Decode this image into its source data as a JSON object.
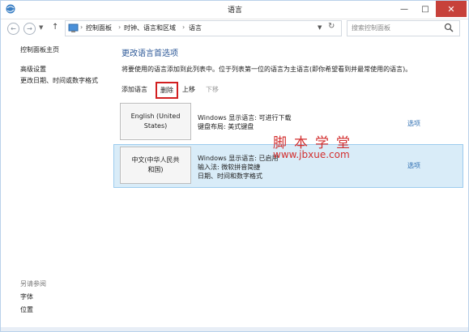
{
  "window": {
    "title": "语言"
  },
  "address": {
    "breadcrumbs": [
      "控制面板",
      "时钟、语言和区域",
      "语言"
    ],
    "separator": "›",
    "search_placeholder": "搜索控制面板"
  },
  "sidebar": {
    "home": "控制面板主页",
    "links": [
      "高级设置",
      "更改日期、时间或数字格式"
    ],
    "see_also_title": "另请参阅",
    "see_also": [
      "字体",
      "位置"
    ]
  },
  "main": {
    "heading": "更改语言首选项",
    "description": "将要使用的语言添加到此列表中。位于列表第一位的语言为主语言(即你希望看到并最常使用的语言)。",
    "toolbar": {
      "add": "添加语言",
      "remove": "删除",
      "up": "上移",
      "down": "下移"
    },
    "languages": [
      {
        "name": "English (United States)",
        "details": [
          "Windows 显示语言: 可进行下载",
          "键盘布局: 美式键盘"
        ],
        "options": "选项",
        "selected": false
      },
      {
        "name": "中文(中华人民共和国)",
        "details": [
          "Windows 显示语言: 已启用",
          "输入法: 微软拼音简捷",
          "日期、时间和数字格式"
        ],
        "options": "选项",
        "selected": true
      }
    ]
  },
  "watermark": {
    "line1": "脚本学堂",
    "line2": "www.jbxue.com"
  },
  "colors": {
    "accent": "#2b5797",
    "link": "#2b6cb0",
    "selected_row": "#d9ecf8",
    "highlight_border": "#d21f20",
    "close_button": "#c7413a"
  },
  "icons": [
    "app-icon",
    "minimize-icon",
    "maximize-icon",
    "close-icon",
    "back-arrow-icon",
    "forward-arrow-icon",
    "history-dropdown-icon",
    "up-arrow-icon",
    "control-panel-icon",
    "address-dropdown-icon",
    "refresh-icon",
    "search-icon"
  ]
}
